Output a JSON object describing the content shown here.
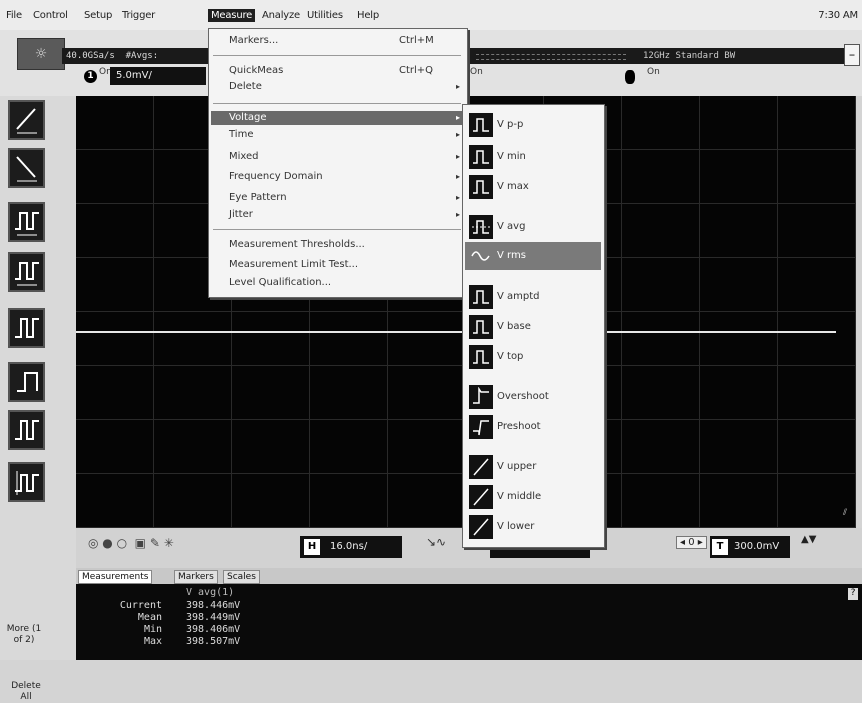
{
  "menubar": {
    "items": [
      "File",
      "Control",
      "Setup",
      "Trigger",
      "Measure",
      "Analyze",
      "Utilities",
      "Help"
    ],
    "clock": "7:30 AM"
  },
  "toolbar": {
    "sample_rate": "40.0GSa/s",
    "avgs": "#Avgs:",
    "bandwidth": "12GHz Standard BW",
    "ch1_badge": "1",
    "ch1_state": "On",
    "ch1_scale": "5.0mV/",
    "ch3_state": "On",
    "ch4_state": "On",
    "sun_icon": "brightness-icon",
    "min_label": "_"
  },
  "measure_menu": {
    "items": [
      {
        "label": "Markers...",
        "shortcut": "Ctrl+M"
      },
      {
        "label": "QuickMeas",
        "shortcut": "Ctrl+Q"
      },
      {
        "label": "Delete"
      },
      {
        "label": "Voltage"
      },
      {
        "label": "Time"
      },
      {
        "label": "Mixed"
      },
      {
        "label": "Frequency Domain"
      },
      {
        "label": "Eye Pattern"
      },
      {
        "label": "Jitter"
      },
      {
        "label": "Measurement Thresholds..."
      },
      {
        "label": "Measurement Limit Test..."
      },
      {
        "label": "Level Qualification..."
      }
    ]
  },
  "voltage_submenu": {
    "items": [
      "V p-p",
      "V min",
      "V max",
      "V avg",
      "V rms",
      "V amptd",
      "V base",
      "V top",
      "Overshoot",
      "Preshoot",
      "V upper",
      "V middle",
      "V lower"
    ],
    "selected": "V rms"
  },
  "left_panel": {
    "more": "More (1 of 2)",
    "delete": "Delete All"
  },
  "controls": {
    "h_label": "H",
    "h_value": "16.0ns/",
    "t_label": "T",
    "t_value": "300.0mV",
    "step": "0"
  },
  "tabs": [
    "Measurements",
    "Markers",
    "Scales"
  ],
  "measurements": {
    "header": "V avg(1)",
    "rows": [
      {
        "label": "Current",
        "value": "398.446mV"
      },
      {
        "label": "Mean",
        "value": "398.449mV"
      },
      {
        "label": "Min",
        "value": "398.406mV"
      },
      {
        "label": "Max",
        "value": "398.507mV"
      }
    ],
    "help": "?"
  }
}
